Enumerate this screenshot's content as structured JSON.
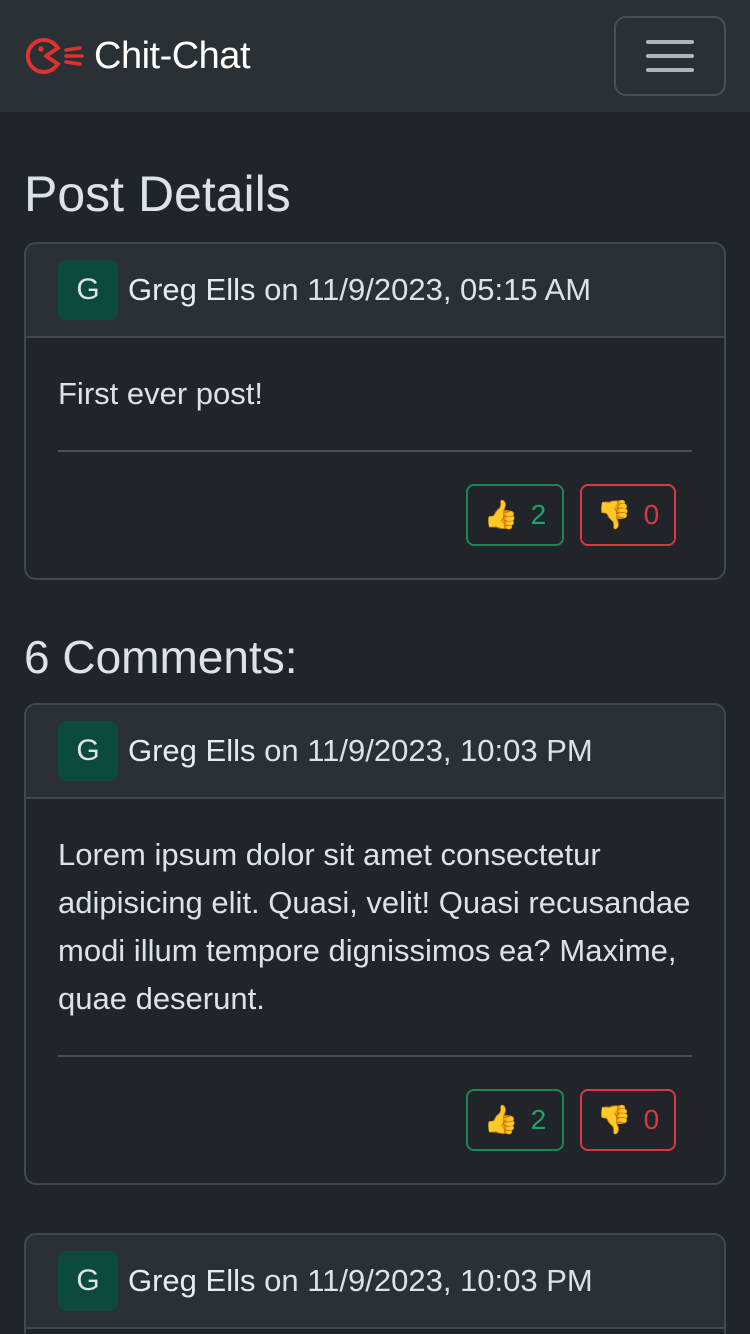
{
  "navbar": {
    "brand": "Chit-Chat",
    "brand_icon": "pacman-chat-logo-icon",
    "toggler_icon": "hamburger-menu-icon"
  },
  "page_title": "Post Details",
  "post": {
    "avatar_letter": "G",
    "author": "Greg Ells",
    "on": "on",
    "timestamp": "11/9/2023, 05:15 AM",
    "content": "First ever post!",
    "likes": "2",
    "dislikes": "0"
  },
  "comments_title": "6 Comments:",
  "comments": [
    {
      "avatar_letter": "G",
      "author": "Greg Ells",
      "on": "on",
      "timestamp": "11/9/2023, 10:03 PM",
      "content": "Lorem ipsum dolor sit amet consectetur adipisicing elit. Quasi, velit! Quasi recusandae modi illum tempore dignissimos ea? Maxime, quae deserunt.",
      "likes": "2",
      "dislikes": "0"
    },
    {
      "avatar_letter": "G",
      "author": "Greg Ells",
      "on": "on",
      "timestamp": "11/9/2023, 10:03 PM"
    }
  ],
  "icons": {
    "like": "👍",
    "dislike": "👎"
  },
  "colors": {
    "background": "#212529",
    "navbar": "#2b3035",
    "avatar": "#0c4a3c",
    "like": "#198754",
    "dislike": "#dc3545",
    "brand_logo": "#e03131"
  }
}
